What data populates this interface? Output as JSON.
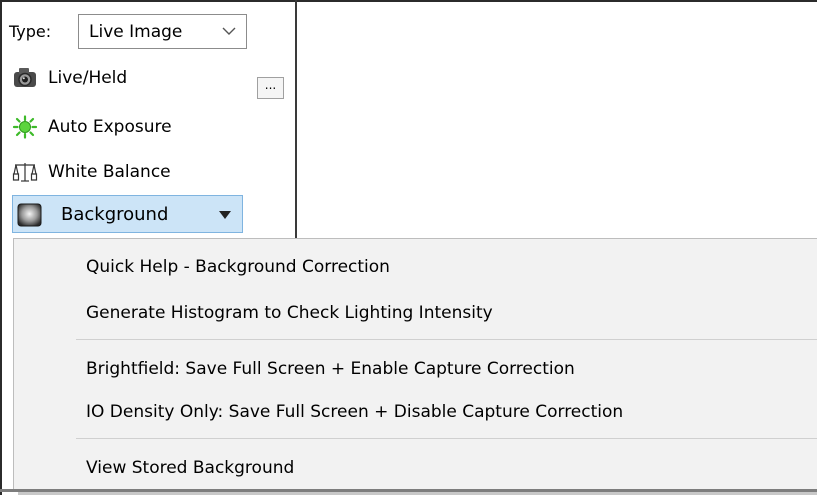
{
  "toolbar": {
    "type_label": "Type:",
    "type_selected": "Live Image",
    "tools": [
      {
        "label": "Live/Held",
        "icon": "camera-icon"
      },
      {
        "label": "Auto Exposure",
        "icon": "sun-icon"
      },
      {
        "label": "White Balance",
        "icon": "balance-scale-icon"
      }
    ],
    "ellipsis_label": "...",
    "background_button": {
      "label": "Background",
      "icon": "background-square-icon"
    }
  },
  "menu": {
    "items": [
      "Quick Help - Background Correction",
      "Generate Histogram to Check Lighting Intensity",
      "Brightfield: Save Full Screen + Enable Capture Correction",
      "IO Density Only: Save Full Screen + Disable Capture Correction",
      "View Stored Background"
    ]
  },
  "colors": {
    "button_highlight": "#cce4f7",
    "button_highlight_border": "#7fb4e0",
    "menu_background": "#f2f2f2",
    "sun_icon": "#3dba29"
  }
}
